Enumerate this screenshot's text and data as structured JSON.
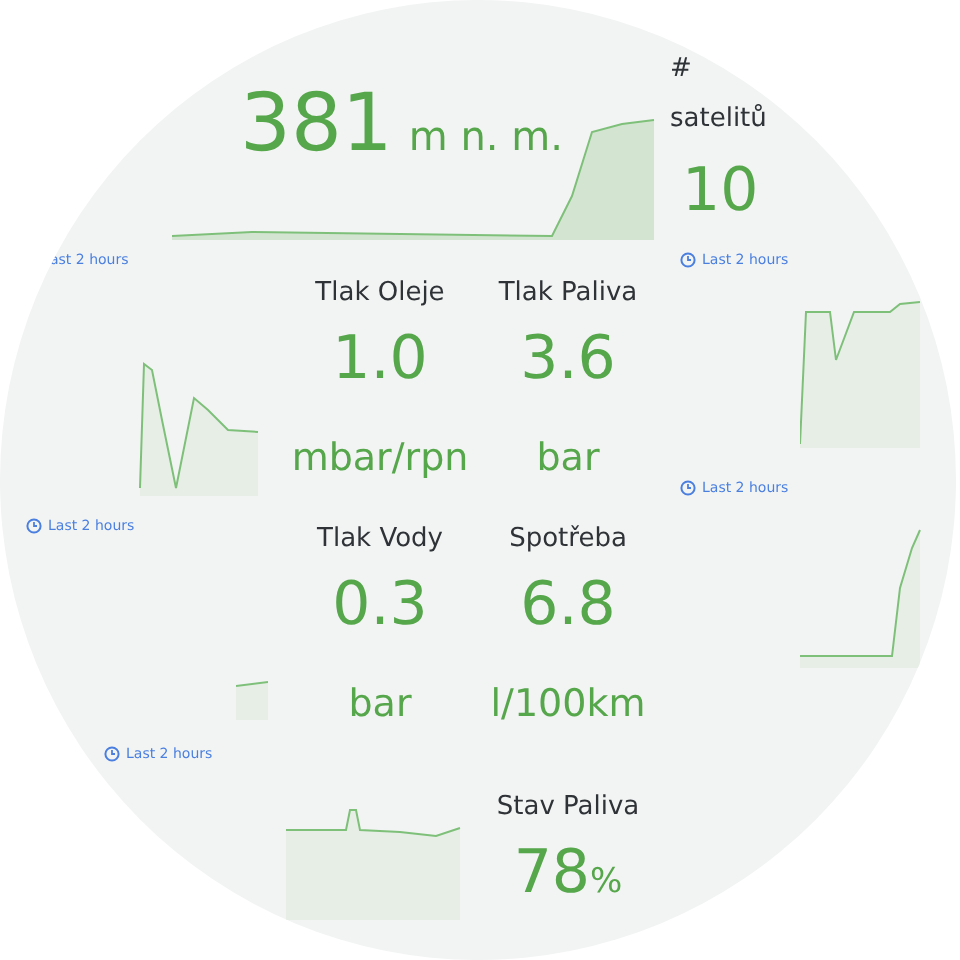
{
  "altitude": {
    "value": "381",
    "unit": "m n. m."
  },
  "satellites": {
    "title": "# satelitů",
    "value": "10"
  },
  "stats": [
    {
      "title": "Tlak Oleje",
      "value": "1.0",
      "unit": "mbar/rpn"
    },
    {
      "title": "Tlak Paliva",
      "value": "3.6",
      "unit": "bar"
    },
    {
      "title": "Tlak Vody",
      "value": "0.3",
      "unit": "bar"
    },
    {
      "title": "Spotřeba",
      "value": "6.8",
      "unit": "l/100km"
    }
  ],
  "fuel_level": {
    "title": "Stav Paliva",
    "value": "78",
    "unit": "%"
  },
  "time_links": [
    {
      "label": "ast 2 hours",
      "icon": false
    },
    {
      "label": "Last 2 hours",
      "icon": true
    },
    {
      "label": "Last 2 hours",
      "icon": true
    },
    {
      "label": "Last 2 hours",
      "icon": true
    },
    {
      "label": "Last 2 hours",
      "icon": true
    }
  ]
}
